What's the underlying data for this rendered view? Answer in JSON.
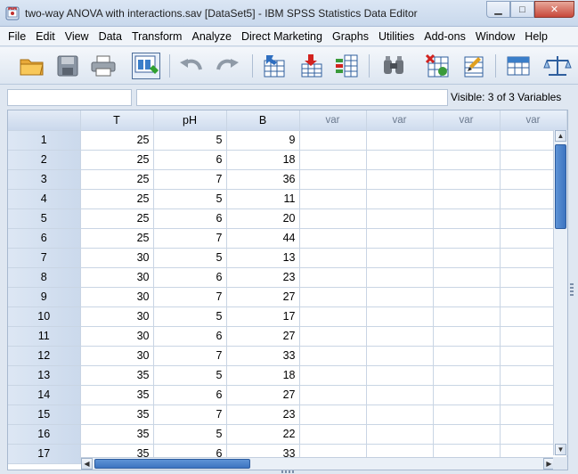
{
  "window": {
    "title": "two-way ANOVA with interactions.sav [DataSet5] - IBM SPSS Statistics Data Editor",
    "min_label": "▁",
    "max_label": "□",
    "close_label": "✕"
  },
  "menu": [
    "File",
    "Edit",
    "View",
    "Data",
    "Transform",
    "Analyze",
    "Direct Marketing",
    "Graphs",
    "Utilities",
    "Add-ons",
    "Window",
    "Help"
  ],
  "toolbar": {
    "icons": [
      "open-folder-icon",
      "save-icon",
      "print-icon",
      "recall-dialog-icon",
      "undo-icon",
      "redo-icon",
      "goto-case-icon",
      "insert-case-icon",
      "insert-variable-icon",
      "find-icon",
      "split-file-icon",
      "select-cases-icon",
      "value-labels-icon",
      "weight-cases-icon"
    ]
  },
  "editor": {
    "cell_reference": "",
    "cell_value": "",
    "visible_text": "Visible: 3 of 3 Variables"
  },
  "grid": {
    "columns": [
      "T",
      "pH",
      "B",
      "var",
      "var",
      "var",
      "var"
    ],
    "rows": [
      {
        "n": "1",
        "T": "25",
        "pH": "5",
        "B": "9"
      },
      {
        "n": "2",
        "T": "25",
        "pH": "6",
        "B": "18"
      },
      {
        "n": "3",
        "T": "25",
        "pH": "7",
        "B": "36"
      },
      {
        "n": "4",
        "T": "25",
        "pH": "5",
        "B": "11"
      },
      {
        "n": "5",
        "T": "25",
        "pH": "6",
        "B": "20"
      },
      {
        "n": "6",
        "T": "25",
        "pH": "7",
        "B": "44"
      },
      {
        "n": "7",
        "T": "30",
        "pH": "5",
        "B": "13"
      },
      {
        "n": "8",
        "T": "30",
        "pH": "6",
        "B": "23"
      },
      {
        "n": "9",
        "T": "30",
        "pH": "7",
        "B": "27"
      },
      {
        "n": "10",
        "T": "30",
        "pH": "5",
        "B": "17"
      },
      {
        "n": "11",
        "T": "30",
        "pH": "6",
        "B": "27"
      },
      {
        "n": "12",
        "T": "30",
        "pH": "7",
        "B": "33"
      },
      {
        "n": "13",
        "T": "35",
        "pH": "5",
        "B": "18"
      },
      {
        "n": "14",
        "T": "35",
        "pH": "6",
        "B": "27"
      },
      {
        "n": "15",
        "T": "35",
        "pH": "7",
        "B": "23"
      },
      {
        "n": "16",
        "T": "35",
        "pH": "5",
        "B": "22"
      },
      {
        "n": "17",
        "T": "35",
        "pH": "6",
        "B": "33"
      }
    ]
  },
  "colors": {
    "accent": "#3c74c0",
    "header_bg": "#cfdcee",
    "grid_line": "#c9d5e4"
  }
}
